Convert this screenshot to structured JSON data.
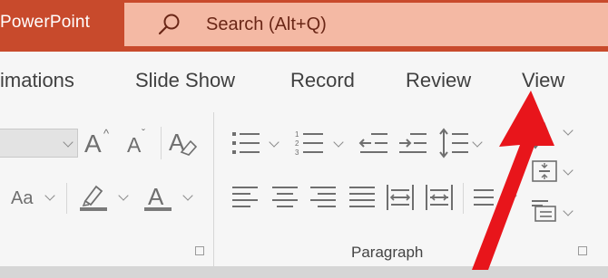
{
  "app": {
    "name": "PowerPoint"
  },
  "search": {
    "label": "Search (Alt+Q)"
  },
  "ribbon_tabs": [
    "imations",
    "Slide Show",
    "Record",
    "Review",
    "View"
  ],
  "font_group": {
    "increase_font": "A",
    "decrease_font": "A",
    "change_case": "Aa",
    "font_color_letter": "A"
  },
  "paragraph_group": {
    "label": "Paragraph"
  },
  "colors": {
    "title_bar": "#c84a2c",
    "search_box": "#f4b9a4",
    "ribbon": "#f6f6f6",
    "arrow": "#e8151b"
  }
}
